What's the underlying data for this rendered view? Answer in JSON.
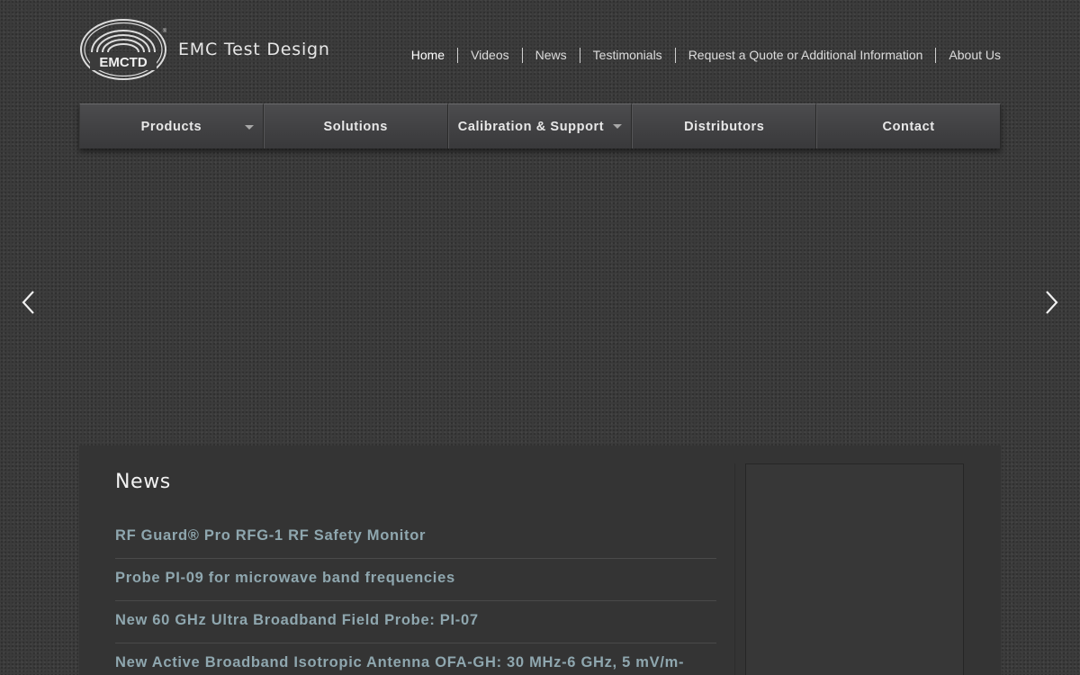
{
  "header": {
    "logo_text": "EMCTD",
    "site_name": "EMC Test Design"
  },
  "top_nav": [
    {
      "label": "Home",
      "active": true
    },
    {
      "label": "Videos"
    },
    {
      "label": "News"
    },
    {
      "label": "Testimonials"
    },
    {
      "label": "Request a Quote or Additional Information"
    },
    {
      "label": "About Us"
    }
  ],
  "main_menu": [
    {
      "label": "Products",
      "dropdown": true
    },
    {
      "label": "Solutions"
    },
    {
      "label": "Calibration & Support",
      "dropdown": true
    },
    {
      "label": "Distributors"
    },
    {
      "label": "Contact"
    }
  ],
  "news": {
    "heading": "News",
    "items": [
      "RF Guard® Pro RFG-1 RF Safety Monitor",
      "Probe PI-09 for microwave band frequencies",
      "New 60 GHz Ultra Broadband Field Probe: PI-07",
      "New Active Broadband Isotropic Antenna OFA-GH: 30 MHz-6 GHz, 5 mV/m-"
    ]
  },
  "icons": {
    "prev": "chevron-left-icon",
    "next": "chevron-right-icon"
  },
  "colors": {
    "background": "#3b3b3b",
    "menu": "#434345",
    "news_link": "#8fa7af"
  }
}
